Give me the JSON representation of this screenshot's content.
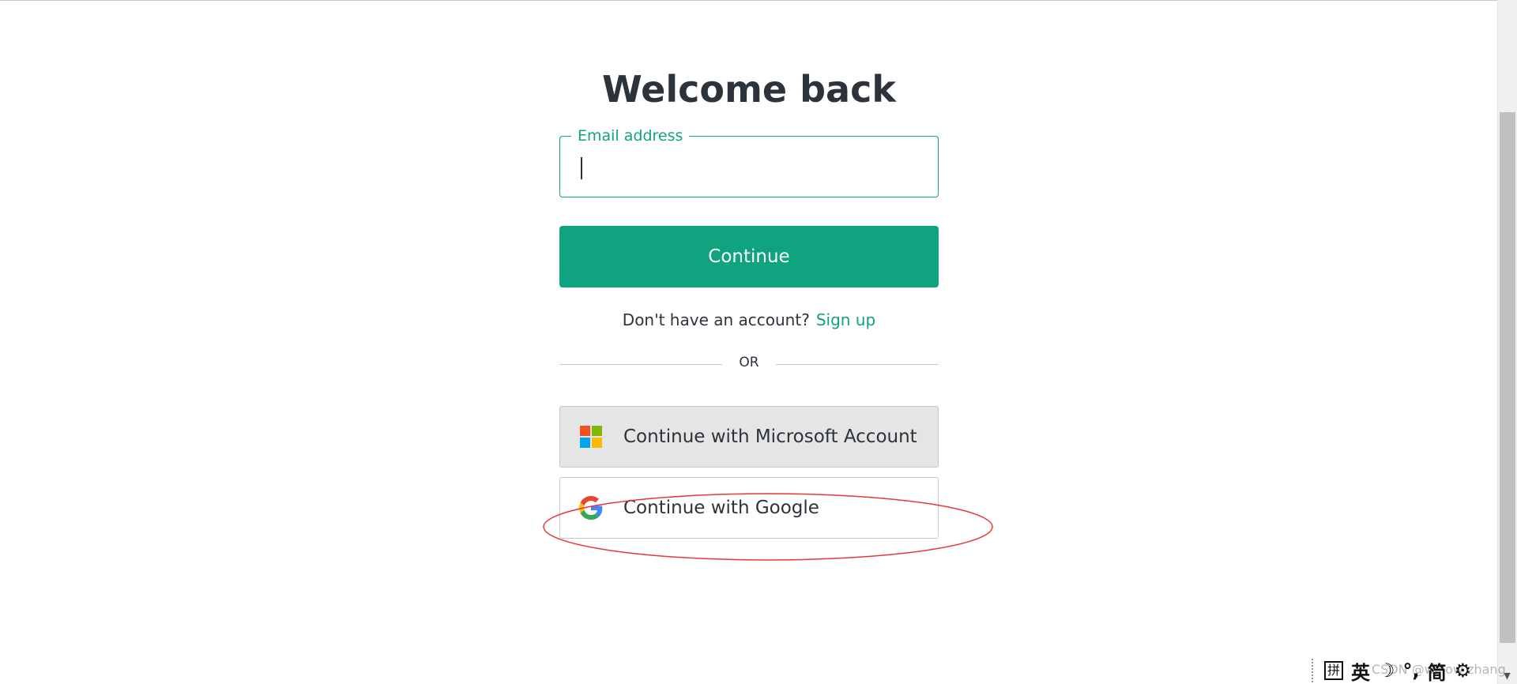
{
  "title": "Welcome back",
  "email": {
    "label": "Email address",
    "value": "",
    "placeholder": ""
  },
  "continue_button": "Continue",
  "signup": {
    "prompt": "Don't have an account?",
    "link": "Sign up"
  },
  "divider_text": "OR",
  "social": {
    "microsoft": {
      "label": "Continue with Microsoft Account",
      "icon": "microsoft-logo-icon"
    },
    "google": {
      "label": "Continue with Google",
      "icon": "google-logo-icon"
    }
  },
  "annotation": {
    "shape": "ellipse",
    "color": "#e8373a",
    "target": "Continue with Google"
  },
  "ime": {
    "grid": "拼",
    "mode": "英",
    "moon": "☽",
    "punct": "°,",
    "script": "简",
    "settings": "⚙"
  },
  "watermark": "CSDN @willow zhang",
  "colors": {
    "accent": "#10a37f",
    "text": "#2d333a",
    "border": "#c2c8d0",
    "ms_button_bg": "#e5e5e5"
  }
}
